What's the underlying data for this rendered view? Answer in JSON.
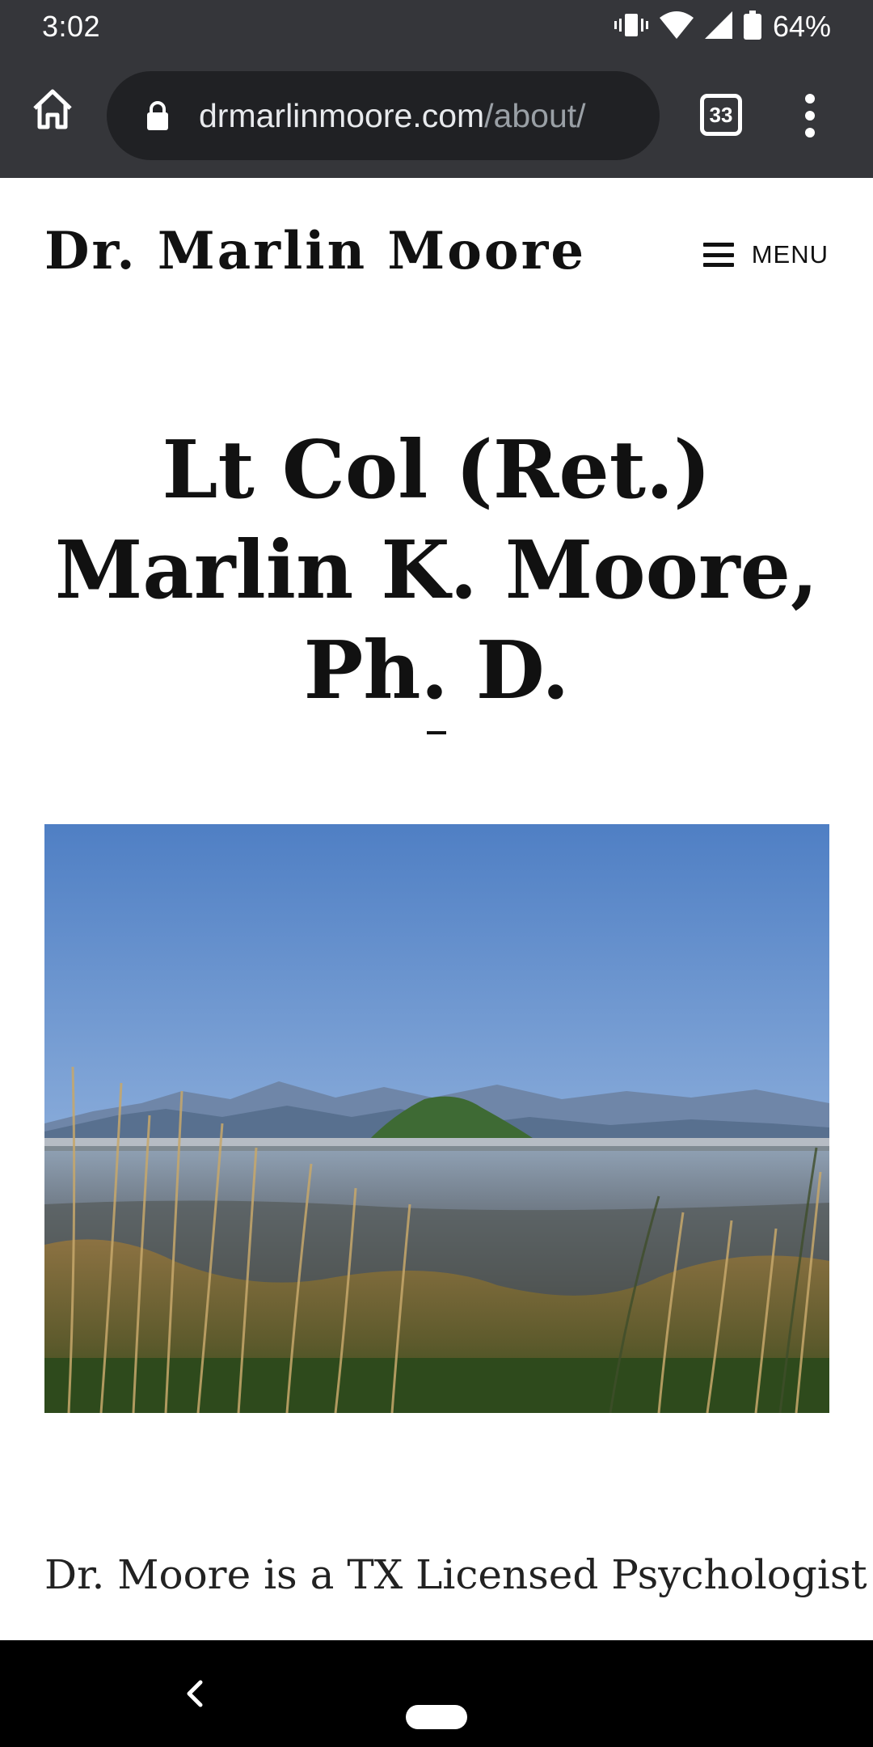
{
  "status_bar": {
    "time": "3:02",
    "battery": "64%",
    "icons": [
      "vibrate-icon",
      "wifi-icon",
      "signal-icon",
      "battery-icon"
    ]
  },
  "browser": {
    "url_domain": "drmarlinmoore.com",
    "url_path": "/about/",
    "tab_count": "33",
    "icons": [
      "home-icon",
      "lock-icon",
      "more-vert-icon"
    ]
  },
  "site": {
    "title": "Dr. Marlin Moore",
    "menu_label": "MENU"
  },
  "page": {
    "heading": "Lt Col (Ret.) Marlin K. Moore, Ph. D.",
    "intro": "Dr. Moore is a TX Licensed Psychologist"
  },
  "nav": {
    "icons": [
      "back-icon",
      "home-pill"
    ]
  },
  "colors": {
    "chrome_bar": "#35363a",
    "url_field": "#202124",
    "text": "#111111"
  }
}
